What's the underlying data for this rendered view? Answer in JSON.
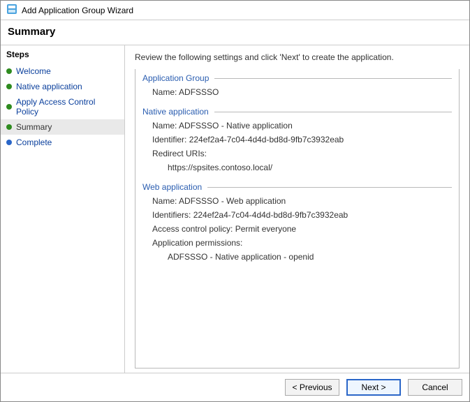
{
  "window": {
    "title": "Add Application Group Wizard"
  },
  "heading": "Summary",
  "steps_title": "Steps",
  "steps": [
    {
      "label": "Welcome",
      "status": "done"
    },
    {
      "label": "Native application",
      "status": "done"
    },
    {
      "label": "Apply Access Control Policy",
      "status": "done"
    },
    {
      "label": "Summary",
      "status": "current"
    },
    {
      "label": "Complete",
      "status": "pending"
    }
  ],
  "instruction": "Review the following settings and click 'Next' to create the application.",
  "sections": {
    "appGroup": {
      "title": "Application Group",
      "name_label": "Name",
      "name_value": "ADFSSSO"
    },
    "native": {
      "title": "Native application",
      "name_label": "Name",
      "name_value": "ADFSSSO - Native application",
      "id_label": "Identifier",
      "id_value": "224ef2a4-7c04-4d4d-bd8d-9fb7c3932eab",
      "redirect_label": "Redirect URIs:",
      "redirect_value": "https://spsites.contoso.local/"
    },
    "web": {
      "title": "Web application",
      "name_label": "Name",
      "name_value": "ADFSSSO - Web application",
      "ids_label": "Identifiers",
      "ids_value": "224ef2a4-7c04-4d4d-bd8d-9fb7c3932eab",
      "acp_label": "Access control policy",
      "acp_value": "Permit everyone",
      "perm_label": "Application permissions:",
      "perm_value": "ADFSSSO - Native application - openid"
    }
  },
  "buttons": {
    "previous": "< Previous",
    "next": "Next >",
    "cancel": "Cancel"
  }
}
